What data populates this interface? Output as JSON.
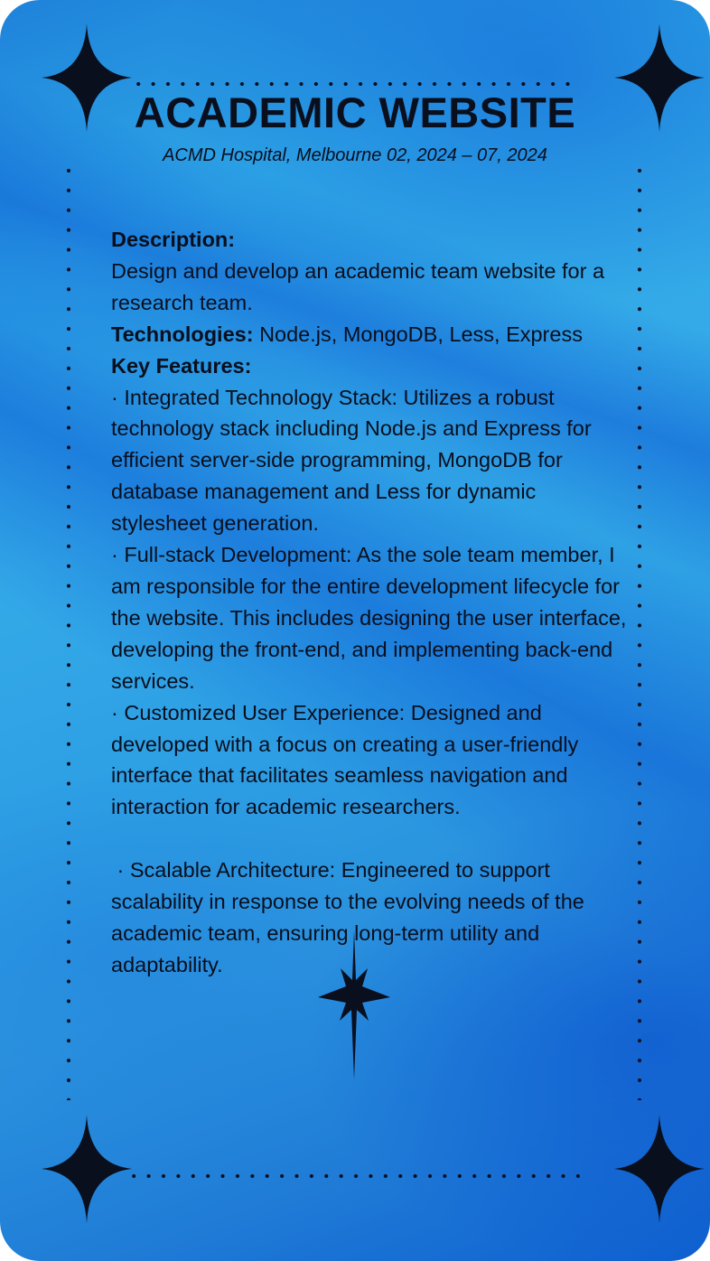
{
  "header": {
    "title": "ACADEMIC WEBSITE",
    "subtitle": "ACMD Hospital, Melbourne 02, 2024 – 07, 2024"
  },
  "body": {
    "description_label": "Description:",
    "description_text": "Design and develop an academic team website for a research team.",
    "technologies_label": "Technologies:",
    "technologies_text": " Node.js, MongoDB, Less, Express",
    "key_features_label": "Key Features:",
    "features": [
      "· Integrated Technology Stack: Utilizes a robust technology stack including Node.js and Express for efficient server-side programming, MongoDB for database management and Less for dynamic stylesheet generation.",
      "· Full-stack Development: As the sole team member, I am responsible for the entire development lifecycle for the website. This includes designing the user interface, developing the front-end, and implementing back-end services.",
      "· Customized User Experience: Designed and developed with a focus on creating a user-friendly interface that facilitates seamless navigation and interaction for academic researchers.",
      " · Scalable Architecture: Engineered to support scalability in response to the evolving needs of the academic team, ensuring long-term utility and adaptability."
    ]
  },
  "decor": {
    "ink_color": "#0a0f1e",
    "bg_light": "#34aae8",
    "bg_dark": "#0f60d0",
    "icons": [
      "sparkle-icon"
    ]
  }
}
